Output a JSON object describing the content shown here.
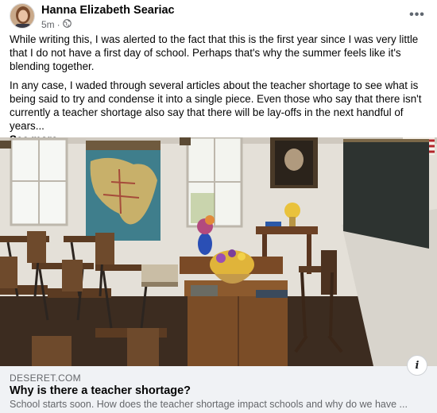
{
  "post": {
    "author": "Hanna Elizabeth Seariac",
    "time": "5m",
    "separator": "·",
    "privacy_icon": "globe-icon",
    "more_label": "•••",
    "paragraphs": [
      "While writing this, I was alerted to the fact that this is the first year since I was very little that I do not have a first day of school. Perhaps that's why the summer feels like it's blending together.",
      "In any case, I waded through several articles about the teacher shortage to see what is being said to try and condense it into a single piece. Even those who say that there isn't currently a teacher shortage also say that there will be lay-offs in the next handful of years..."
    ],
    "see_more": "See more"
  },
  "link": {
    "domain": "DESERET.COM",
    "title": "Why is there a teacher shortage?",
    "description": "School starts soon. How does the teacher shortage impact schools and why do we have ...",
    "info_label": "i"
  },
  "colors": {
    "secondary_text": "#65676b",
    "link_background": "#f0f2f5",
    "primary_text": "#050505"
  }
}
